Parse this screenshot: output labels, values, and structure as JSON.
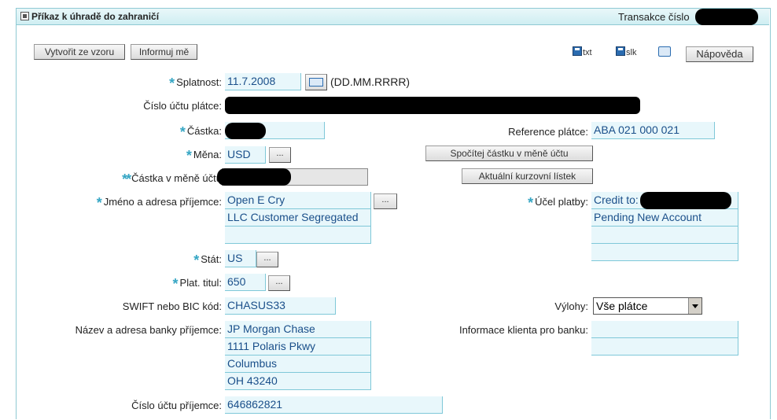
{
  "header": {
    "title": "Příkaz k úhradě do zahraničí",
    "transaction_label": "Transakce číslo"
  },
  "toolbar": {
    "from_template": "Vytvořit ze vzoru",
    "inform_me": "Informuj mě",
    "txt": "txt",
    "slk": "slk",
    "help": "Nápověda"
  },
  "form": {
    "maturity": {
      "label": "Splatnost:",
      "value": "11.7.2008",
      "format": "(DD.MM.RRRR)"
    },
    "payer_account": {
      "label": "Číslo účtu plátce:"
    },
    "amount": {
      "label": "Částka:"
    },
    "payer_reference": {
      "label": "Reference plátce:",
      "value": "ABA 021 000 021"
    },
    "currency": {
      "label": "Měna:",
      "value": "USD"
    },
    "calc_button": "Spočítej částku v měně účtu",
    "account_currency_amount": {
      "label": "Částka v měně účtu"
    },
    "rates_button": "Aktuální kurzovní lístek",
    "beneficiary": {
      "label": "Jméno a adresa příjemce:",
      "lines": [
        "Open E Cry",
        "LLC Customer Segregated",
        ""
      ]
    },
    "purpose": {
      "label": "Účel platby:",
      "lines": [
        "Credit to:",
        "Pending New Account",
        "",
        ""
      ]
    },
    "country": {
      "label": "Stát:",
      "value": "US"
    },
    "title_code": {
      "label": "Plat. titul:",
      "value": "650"
    },
    "swift": {
      "label": "SWIFT nebo BIC kód:",
      "value": "CHASUS33"
    },
    "fees": {
      "label": "Výlohy:",
      "value": "Vše plátce"
    },
    "bank": {
      "label": "Název a adresa banky příjemce:",
      "lines": [
        "JP Morgan Chase",
        "1111 Polaris Pkwy",
        "Columbus",
        "OH 43240"
      ]
    },
    "client_info": {
      "label": "Informace klienta pro banku:",
      "lines": [
        "",
        ""
      ]
    },
    "beneficiary_account": {
      "label": "Číslo účtu příjemce:",
      "value": "646862821"
    }
  },
  "ellipsis": "...",
  "required_mark": "*",
  "double_required_mark": "**"
}
